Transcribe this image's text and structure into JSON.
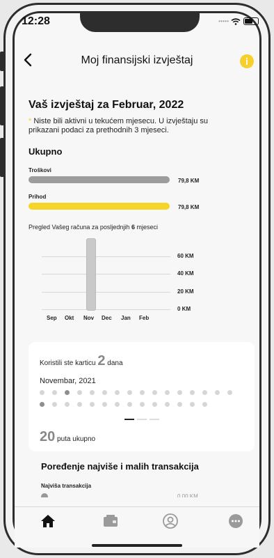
{
  "status": {
    "time": "12:28"
  },
  "header": {
    "title": "Moj finansijski izvještaj",
    "back_icon": "chevron-left-icon",
    "info_icon": "info-icon",
    "accent": "#f6cf2a"
  },
  "report": {
    "heading": "Vaš izvještaj za Februar, 2022",
    "notice_mark": "*",
    "notice": " Niste bili aktivni u tekućem mjesecu. U izvještaju su prikazani podaci za prethodnih 3 mjeseci.",
    "total_heading": "Ukupno",
    "expenses_label": "Troškovi",
    "expenses_value": "79,8 KM",
    "income_label": "Prihod",
    "income_value": "79,8 KM",
    "expenses_color": "#9c9c9c",
    "income_color": "#f6d52a",
    "overview_prefix": "Pregled Vašeg računa za posljednjih ",
    "overview_count": "6",
    "overview_suffix": " mjeseci"
  },
  "chart_data": {
    "type": "bar",
    "categories": [
      "Sep",
      "Okt",
      "Nov",
      "Dec",
      "Jan",
      "Feb"
    ],
    "values": [
      0,
      0,
      79.8,
      0,
      0,
      0
    ],
    "y_tick_labels": [
      "60 KM",
      "40 KM",
      "20 KM",
      "0 KM"
    ],
    "y_ticks": [
      60,
      40,
      20,
      0
    ],
    "ylim": [
      0,
      80
    ],
    "grid": true
  },
  "card": {
    "used_prefix": "Koristili ste karticu ",
    "used_count": "2",
    "used_suffix": " dana",
    "month": "Novembar, 2021",
    "row1_active": [
      2
    ],
    "row2_active": [
      0
    ],
    "row1_count": 16,
    "row2_count": 14,
    "total_count": "20",
    "total_suffix": " puta ukupno"
  },
  "transactions": {
    "heading": "Poređenje najviše i malih transakcija",
    "highest_label": "Najviša transakcija",
    "highest_value": "0,00 KM"
  },
  "tabbar": {
    "items": [
      "home-icon",
      "wallet-icon",
      "profile-icon",
      "more-icon"
    ]
  }
}
